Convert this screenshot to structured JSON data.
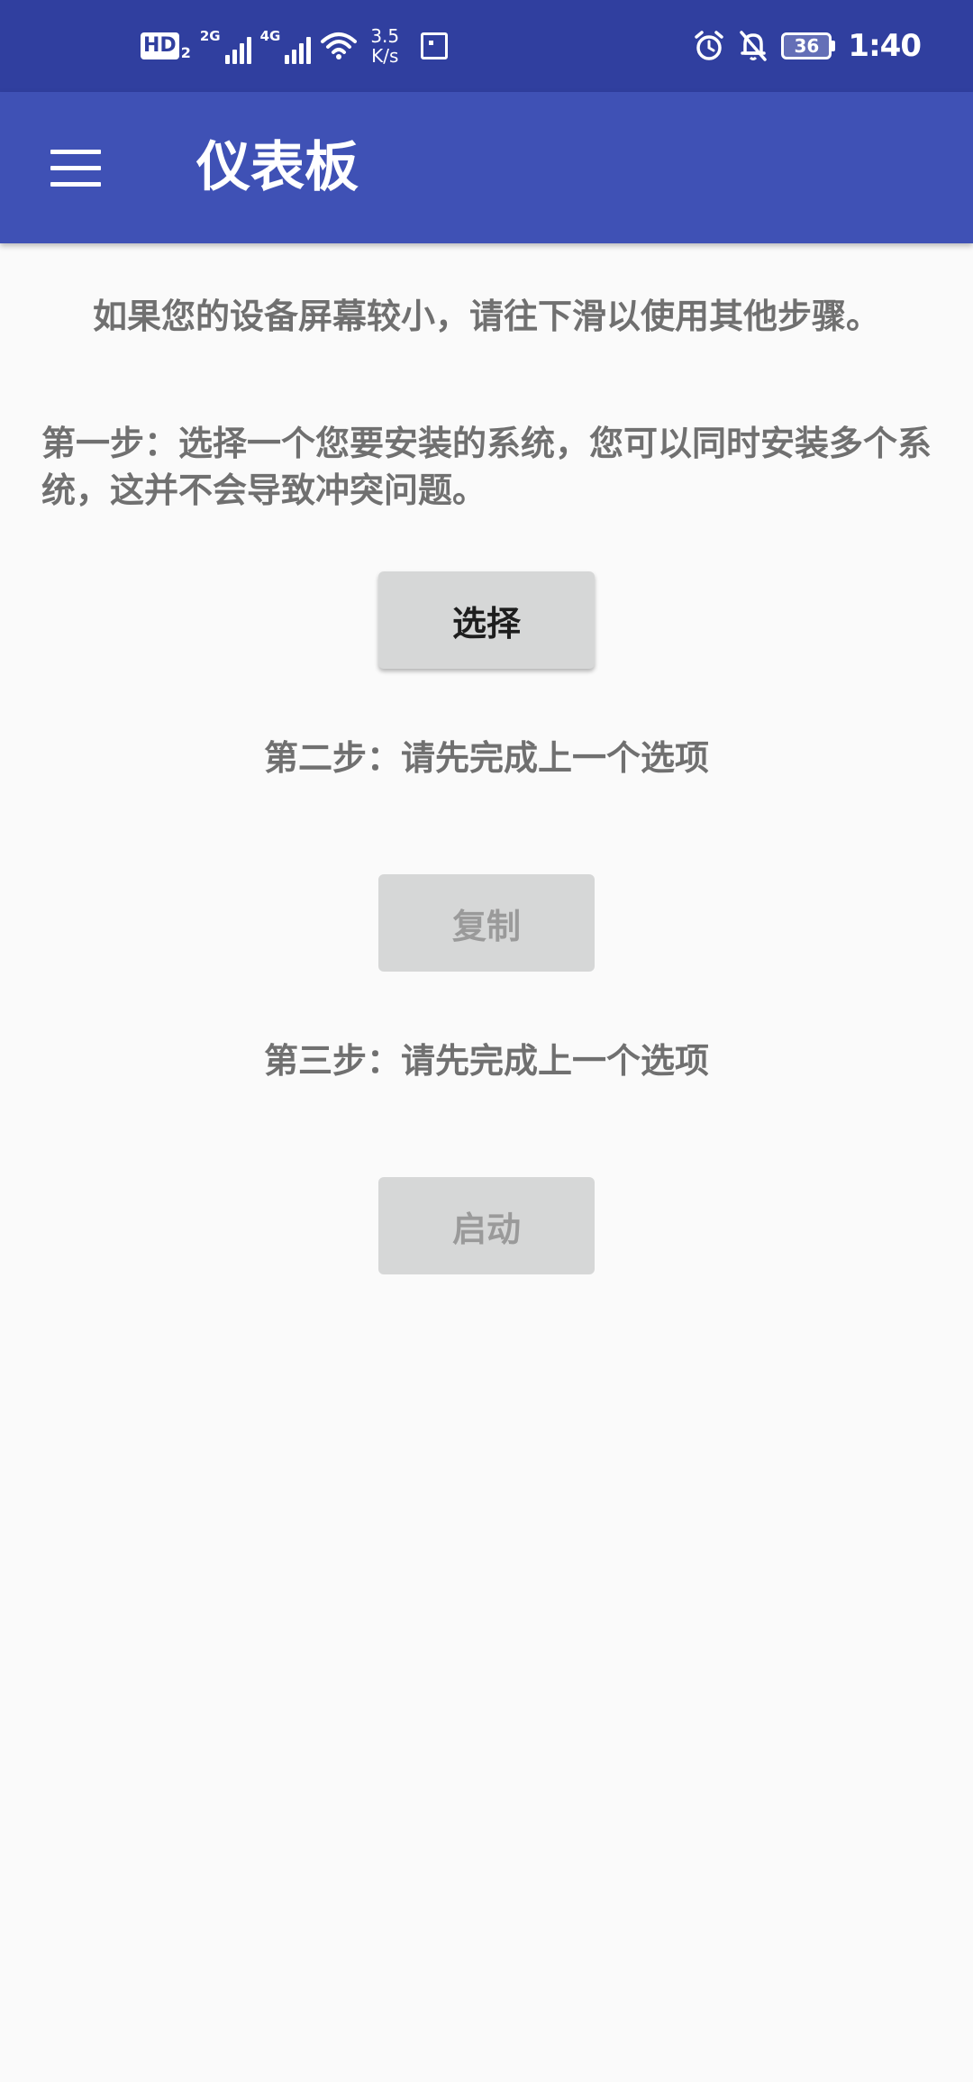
{
  "status_bar": {
    "hd_label": "HD",
    "hd_sub": "2",
    "signal1_gen": "2G",
    "signal2_gen": "4G",
    "speed_value": "3.5",
    "speed_unit": "K/s",
    "battery_level": "36",
    "time": "1:40",
    "icons": [
      "wifi-icon",
      "screenshot-icon",
      "alarm-icon",
      "bell-off-icon",
      "battery-icon"
    ]
  },
  "app_bar": {
    "title": "仪表板",
    "menu_icon": "hamburger-menu-icon"
  },
  "main": {
    "hint": "如果您的设备屏幕较小，请往下滑以使用其他步骤。",
    "step1_text": "第一步：选择一个您要安装的系统，您可以同时安装多个系统，这并不会导致冲突问题。",
    "select_button": "选择",
    "step2_text": "第二步：请先完成上一个选项",
    "copy_button": "复制",
    "step3_text": "第三步：请先完成上一个选项",
    "start_button": "启动"
  },
  "colors": {
    "status_bar": "#303f9f",
    "app_bar": "#3f51b5",
    "background": "#fafafa",
    "button": "#d6d7d7",
    "text_gray": "#707070"
  }
}
